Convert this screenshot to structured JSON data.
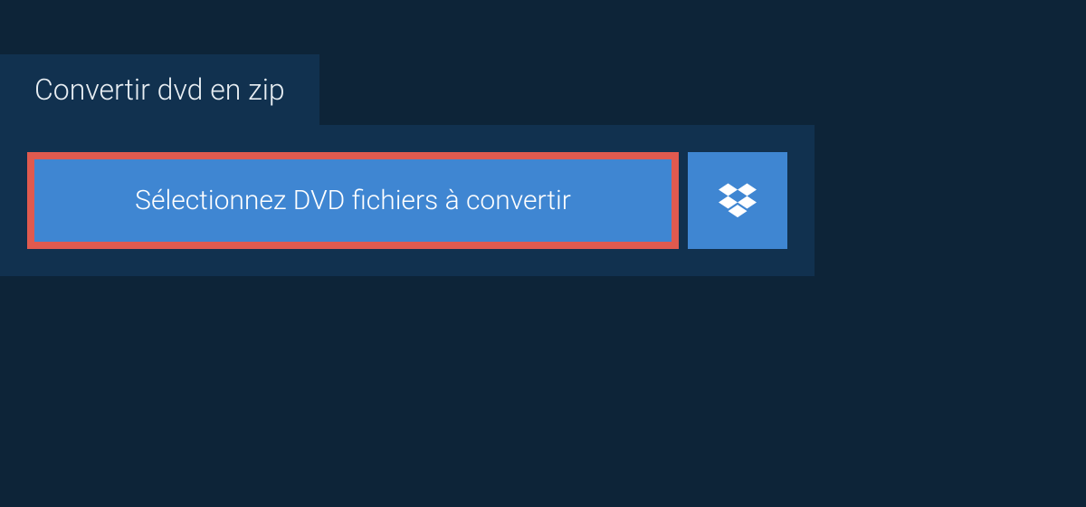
{
  "tab": {
    "label": "Convertir dvd en zip"
  },
  "actions": {
    "select_files_label": "Sélectionnez DVD fichiers à convertir"
  }
}
